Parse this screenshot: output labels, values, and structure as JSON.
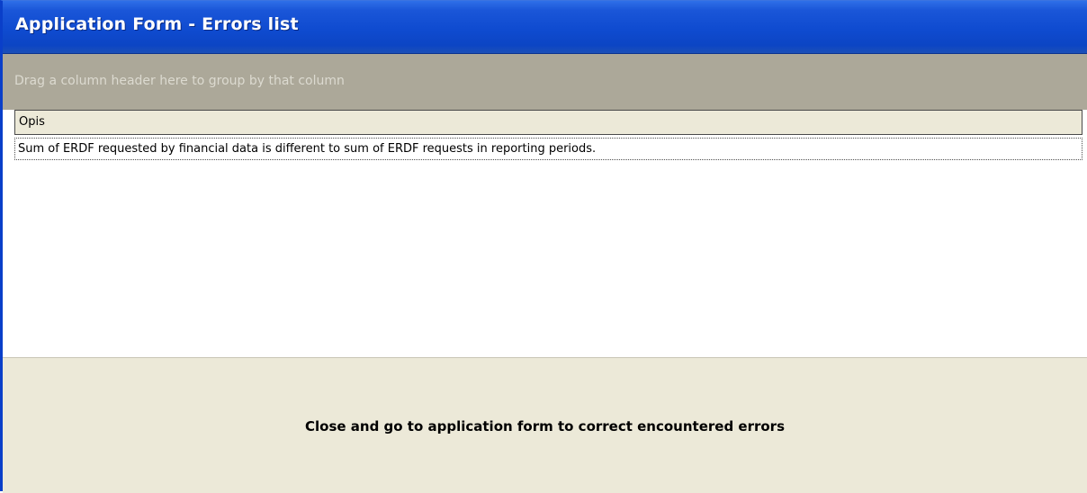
{
  "window": {
    "title": "Application Form - Errors list"
  },
  "grid": {
    "group_hint": "Drag a column header here to group by that column",
    "columns": [
      "Opis"
    ],
    "rows": [
      [
        "Sum of ERDF requested by financial data is different to sum of ERDF requests in reporting periods."
      ]
    ]
  },
  "footer": {
    "close_button_label": "Close and go to application form to correct encountered errors"
  },
  "colors": {
    "titlebar_blue": "#0c45c4",
    "group_panel_gray": "#aca899",
    "panel_beige": "#ece9d8"
  }
}
